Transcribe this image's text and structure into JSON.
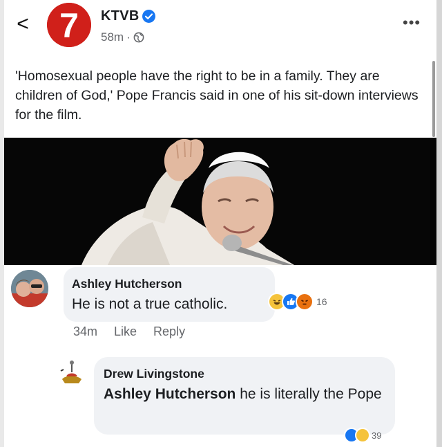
{
  "header": {
    "back_icon": "chevron-left-icon",
    "back_glyph": "<",
    "logo_number": "7",
    "page_name": "KTVB",
    "verified_icon": "verified-badge-icon",
    "time": "58m",
    "separator": "·",
    "privacy_icon": "globe-icon",
    "more_icon": "more-icon",
    "more_glyph": "•••"
  },
  "post": {
    "text": "'Homosexual people have the right to be in a family. They are children of God,' Pope Francis said in one of his sit-down interviews for the film."
  },
  "comments": [
    {
      "author": "Ashley Hutcherson",
      "text": "He is not a true catholic.",
      "reactions": [
        "haha",
        "like",
        "angry"
      ],
      "reaction_count": "16",
      "time": "34m",
      "like_label": "Like",
      "reply_label": "Reply"
    },
    {
      "author": "Drew Livingstone",
      "mention": "Ashley Hutcherson",
      "text": " he is literally the Pope",
      "reactions": [
        "like",
        "haha"
      ],
      "reaction_count": "39"
    }
  ],
  "colors": {
    "brand_red": "#d0201a",
    "facebook_blue": "#1877f2",
    "bubble_gray": "#f0f2f5",
    "meta_gray": "#65676b"
  }
}
